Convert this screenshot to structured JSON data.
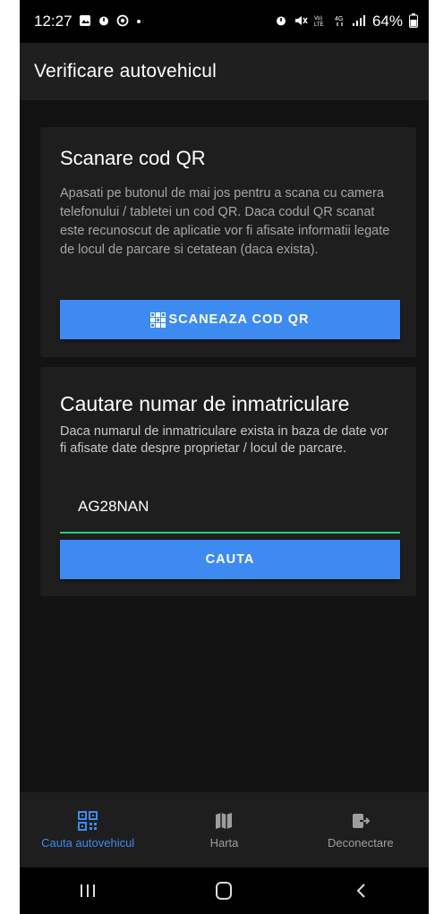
{
  "status_bar": {
    "time": "12:27",
    "battery": "64%",
    "left_icons": [
      "gallery-icon",
      "alarm-icon",
      "vpn-icon",
      "dot-icon"
    ],
    "right_icons": [
      "alarm-icon",
      "mute-icon",
      "volte-icon",
      "4g-icon",
      "signal-icon",
      "battery-icon"
    ]
  },
  "app_bar": {
    "title": "Verificare autovehicul"
  },
  "qr_card": {
    "title": "Scanare cod QR",
    "description": "Apasati pe butonul de mai jos pentru a scana cu camera telefonului / tabletei un cod QR. Daca codul QR scanat este recunoscut de aplicatie vor fi afisate informatii legate de locul de parcare si cetatean (daca exista).",
    "button_label": "SCANEAZA COD QR",
    "button_icon": "qr-code-icon"
  },
  "search_card": {
    "title": "Cautare numar de inmatriculare",
    "description": "Daca numarul de inmatriculare exista in baza de date vor fi afisate date despre proprietar / locul de parcare.",
    "input_value": "AG28NAN",
    "button_label": "CAUTA"
  },
  "bottom_nav": {
    "items": [
      {
        "label": "Cauta autovehicul",
        "icon": "qr-code-icon",
        "active": true
      },
      {
        "label": "Harta",
        "icon": "map-icon",
        "active": false
      },
      {
        "label": "Deconectare",
        "icon": "logout-icon",
        "active": false
      }
    ]
  },
  "system_nav": {
    "buttons": [
      "recents-icon",
      "home-icon",
      "back-icon"
    ]
  },
  "colors": {
    "accent": "#3d8bf0",
    "background": "#121212",
    "card": "#1e1e1e",
    "input_underline": "#2ecc71"
  }
}
